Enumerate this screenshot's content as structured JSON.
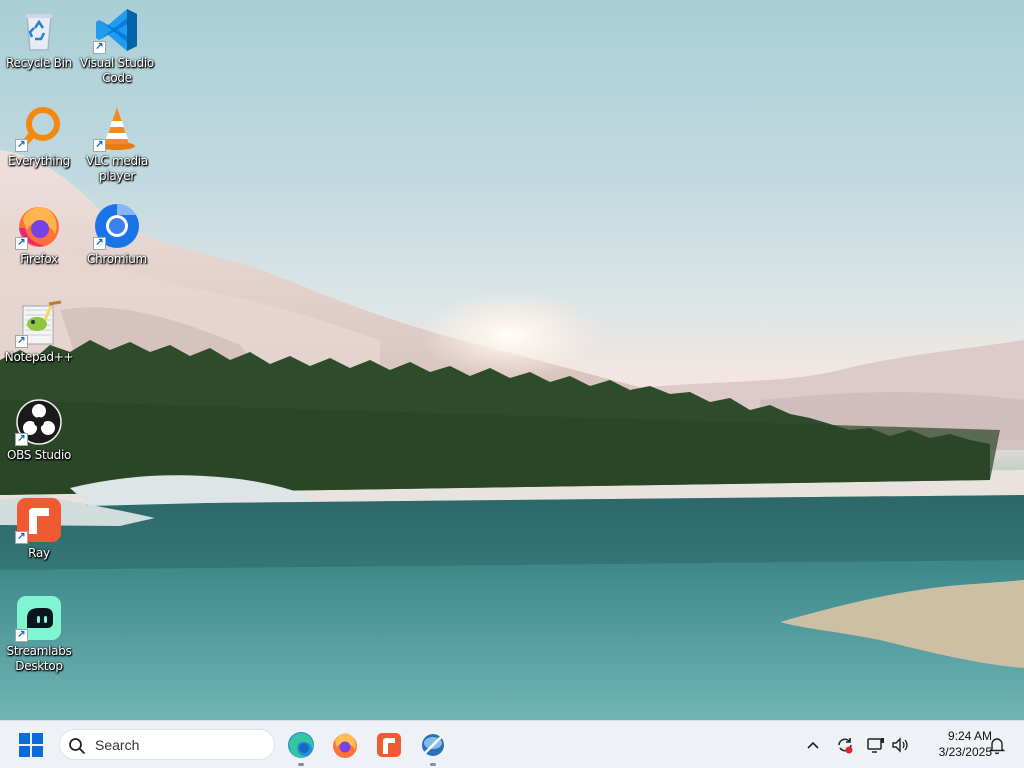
{
  "desktop": {
    "icons": [
      {
        "name": "recycle-bin",
        "label": "Recycle Bin"
      },
      {
        "name": "vscode",
        "label": "Visual Studio Code"
      },
      {
        "name": "everything",
        "label": "Everything"
      },
      {
        "name": "vlc",
        "label": "VLC media player"
      },
      {
        "name": "firefox",
        "label": "Firefox"
      },
      {
        "name": "chromium",
        "label": "Chromium"
      },
      {
        "name": "notepadpp",
        "label": "Notepad++"
      },
      {
        "name": "obs",
        "label": "OBS Studio"
      },
      {
        "name": "ray",
        "label": "Ray"
      },
      {
        "name": "streamlabs",
        "label": "Streamlabs Desktop"
      }
    ]
  },
  "taskbar": {
    "search_placeholder": "Search",
    "pinned": [
      "edge-icon",
      "firefox-icon",
      "ray-icon",
      "app-icon"
    ],
    "tray": [
      "chevron-up-icon",
      "sync-icon",
      "network-icon",
      "volume-icon"
    ],
    "time": "9:24 AM",
    "date": "3/23/2025"
  },
  "colors": {
    "taskbar_bg": "#eef2f7",
    "start_blue": "#0a6cd8"
  }
}
